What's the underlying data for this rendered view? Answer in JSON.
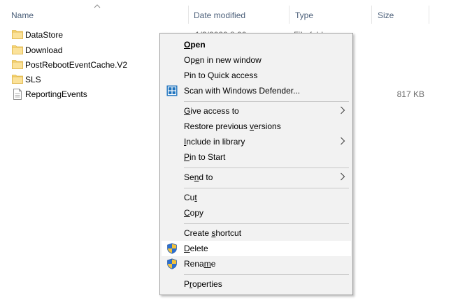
{
  "columns": {
    "name": "Name",
    "date_modified": "Date modified",
    "type": "Type",
    "size": "Size"
  },
  "files": [
    {
      "name": "DataStore",
      "date": "1/3/2020 8:00",
      "type": "File folder",
      "size": "",
      "icon": "folder-icon",
      "selected": true
    },
    {
      "name": "Download",
      "date": "",
      "type": "",
      "size": "",
      "icon": "folder-icon",
      "selected": false
    },
    {
      "name": "PostRebootEventCache.V2",
      "date": "",
      "type": "",
      "size": "",
      "icon": "folder-icon",
      "selected": false
    },
    {
      "name": "SLS",
      "date": "",
      "type": "",
      "size": "",
      "icon": "folder-icon",
      "selected": false
    },
    {
      "name": "ReportingEvents",
      "date": "",
      "type": "",
      "size": "817 KB",
      "icon": "file-icon",
      "selected": false
    }
  ],
  "context_menu": {
    "open": {
      "pre": "",
      "ul": "O",
      "post": "pen"
    },
    "open_new_window": {
      "pre": "Op",
      "ul": "e",
      "post": "n in new window"
    },
    "pin_quick_access": {
      "pre": "Pin to Quick access",
      "ul": "",
      "post": ""
    },
    "scan_defender": {
      "pre": "Scan with Windows Defender...",
      "ul": "",
      "post": ""
    },
    "give_access": {
      "pre": "",
      "ul": "G",
      "post": "ive access to"
    },
    "restore_versions": {
      "pre": "Restore previous ",
      "ul": "v",
      "post": "ersions"
    },
    "include_library": {
      "pre": "",
      "ul": "I",
      "post": "nclude in library"
    },
    "pin_start": {
      "pre": "",
      "ul": "P",
      "post": "in to Start"
    },
    "send_to": {
      "pre": "Se",
      "ul": "n",
      "post": "d to"
    },
    "cut": {
      "pre": "Cu",
      "ul": "t",
      "post": ""
    },
    "copy": {
      "pre": "",
      "ul": "C",
      "post": "opy"
    },
    "create_shortcut": {
      "pre": "Create ",
      "ul": "s",
      "post": "hortcut"
    },
    "delete": {
      "pre": "",
      "ul": "D",
      "post": "elete"
    },
    "rename": {
      "pre": "Rena",
      "ul": "m",
      "post": "e"
    },
    "properties": {
      "pre": "P",
      "ul": "r",
      "post": "operties"
    }
  },
  "colors": {
    "selection_bg": "#cce8ff",
    "selection_border": "#99d1ff",
    "menu_bg": "#f2f2f2",
    "header_text": "#4c607a",
    "folder_yellow": "#f8d775"
  }
}
